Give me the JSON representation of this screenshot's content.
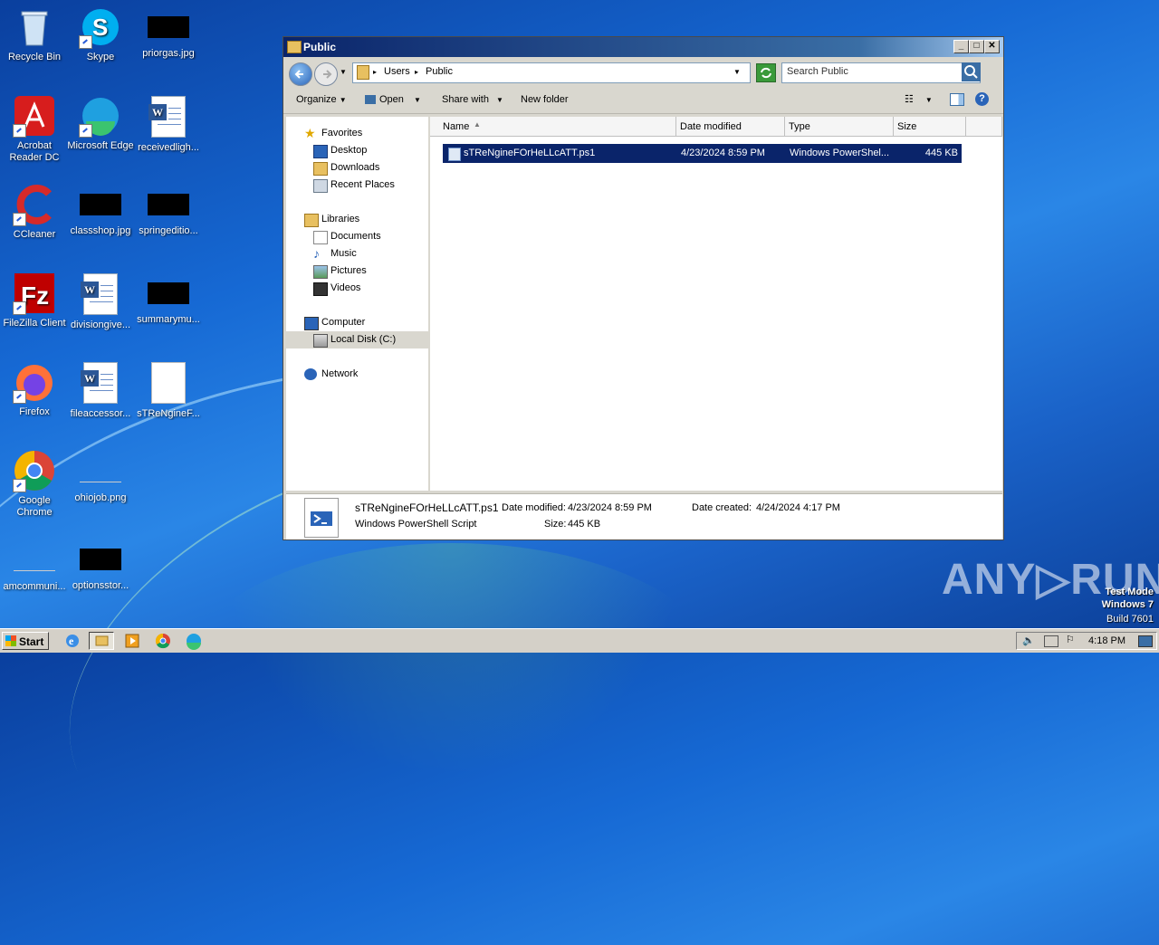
{
  "desktop": {
    "icons": [
      {
        "label": "Recycle Bin"
      },
      {
        "label": "Skype"
      },
      {
        "label": "priorgas.jpg"
      },
      {
        "label": "Acrobat Reader DC"
      },
      {
        "label": "Microsoft Edge"
      },
      {
        "label": "receivedligh..."
      },
      {
        "label": "CCleaner"
      },
      {
        "label": "classshop.jpg"
      },
      {
        "label": "springeditio..."
      },
      {
        "label": "FileZilla Client"
      },
      {
        "label": "divisiongive..."
      },
      {
        "label": "summarymu..."
      },
      {
        "label": "Firefox"
      },
      {
        "label": "fileaccessor..."
      },
      {
        "label": "sTReNgineF..."
      },
      {
        "label": "Google Chrome"
      },
      {
        "label": "ohiojob.png"
      },
      {
        "label": "amcommuni..."
      },
      {
        "label": "optionsstor..."
      }
    ]
  },
  "window": {
    "title": "Public",
    "address": {
      "crumbs": [
        "Users",
        "Public"
      ]
    },
    "search_placeholder": "Search Public",
    "toolbar": {
      "organize": "Organize",
      "open": "Open",
      "share": "Share with",
      "new_folder": "New folder"
    },
    "nav": {
      "favorites": "Favorites",
      "desktop": "Desktop",
      "downloads": "Downloads",
      "recent": "Recent Places",
      "libraries": "Libraries",
      "documents": "Documents",
      "music": "Music",
      "pictures": "Pictures",
      "videos": "Videos",
      "computer": "Computer",
      "local_disk": "Local Disk (C:)",
      "network": "Network"
    },
    "columns": {
      "name": "Name",
      "date": "Date modified",
      "type": "Type",
      "size": "Size"
    },
    "file": {
      "name": "sTReNgineFOrHeLLcATT.ps1",
      "date": "4/23/2024 8:59 PM",
      "type": "Windows PowerShel...",
      "size": "445 KB"
    },
    "details": {
      "filename": "sTReNgineFOrHeLLcATT.ps1",
      "filetype": "Windows PowerShell Script",
      "modified_label": "Date modified:",
      "modified_value": "4/23/2024 8:59 PM",
      "size_label": "Size:",
      "size_value": "445 KB",
      "created_label": "Date created:",
      "created_value": "4/24/2024 4:17 PM"
    }
  },
  "taskbar": {
    "start": "Start",
    "clock": "4:18 PM"
  },
  "watermark": {
    "brand": "ANY▷RUN",
    "line1": "Test Mode",
    "line2": "Windows 7",
    "line3": "Build 7601"
  },
  "colors": {
    "selection": "#0a246a",
    "titlebar": "#0a246a",
    "desktop": "#1669d4"
  }
}
